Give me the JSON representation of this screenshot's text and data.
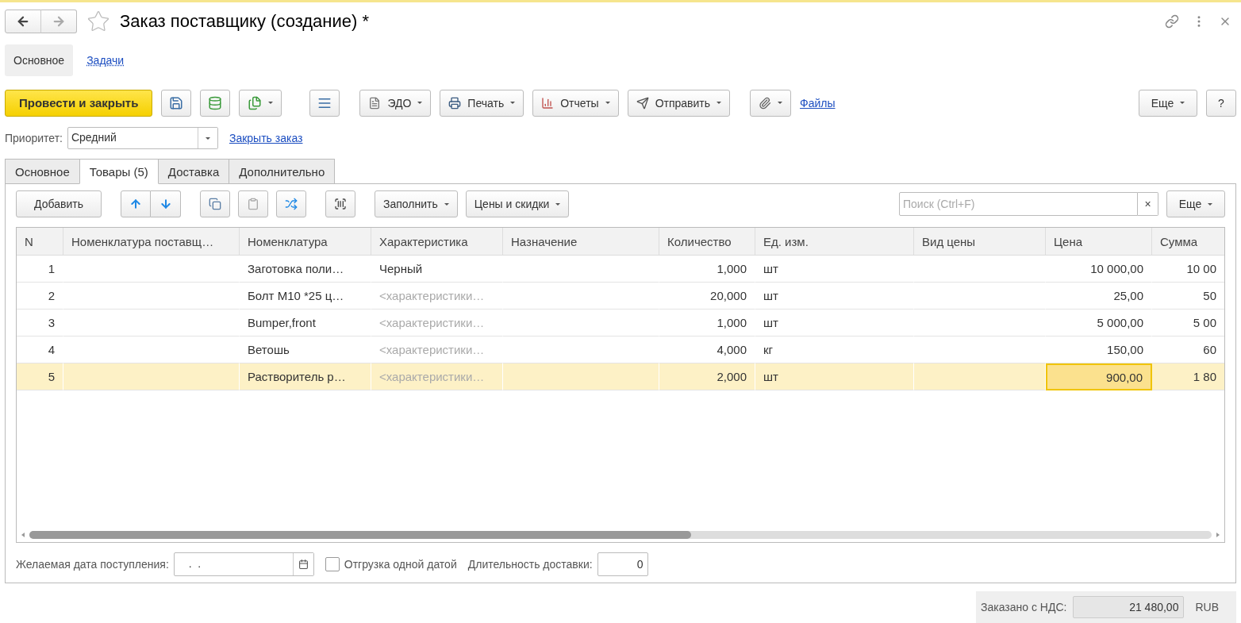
{
  "window": {
    "title": "Заказ поставщику (создание) *",
    "favorite": false
  },
  "sections": [
    {
      "label": "Основное",
      "selected": true
    },
    {
      "label": "Задачи",
      "selected": false
    }
  ],
  "toolbar": {
    "primary": "Провести и закрыть",
    "edo": "ЭДО",
    "print": "Печать",
    "reports": "Отчеты",
    "send": "Отправить",
    "files": "Файлы",
    "more": "Еще",
    "help": "?"
  },
  "priority": {
    "label": "Приоритет:",
    "value": "Средний"
  },
  "close_order_link": "Закрыть заказ",
  "tabs": [
    {
      "label": "Основное",
      "selected": false
    },
    {
      "label": "Товары (5)",
      "selected": true
    },
    {
      "label": "Доставка",
      "selected": false
    },
    {
      "label": "Дополнительно",
      "selected": false
    }
  ],
  "table_toolbar": {
    "add": "Добавить",
    "fill": "Заполнить",
    "prices": "Цены и скидки",
    "search_placeholder": "Поиск (Ctrl+F)",
    "clear": "×",
    "more": "Еще"
  },
  "table": {
    "columns": [
      "N",
      "Номенклатура поставщ…",
      "Номенклатура",
      "Характеристика",
      "Назначение",
      "Количество",
      "Ед. изм.",
      "Вид цены",
      "Цена",
      "Сумма"
    ],
    "rows": [
      {
        "n": "1",
        "supplier_item": "",
        "item": "Заготовка поли…",
        "characteristic": "Черный",
        "characteristic_empty": false,
        "purpose": "",
        "quantity": "1,000",
        "unit": "шт",
        "price_type": "",
        "price": "10 000,00",
        "sum": "10 00",
        "selected": false
      },
      {
        "n": "2",
        "supplier_item": "",
        "item": "Болт  М10 *25 ц…",
        "characteristic": "<характеристики…",
        "characteristic_empty": true,
        "purpose": "",
        "quantity": "20,000",
        "unit": "шт",
        "price_type": "",
        "price": "25,00",
        "sum": "50",
        "selected": false
      },
      {
        "n": "3",
        "supplier_item": "",
        "item": "Bumper,front",
        "characteristic": "<характеристики…",
        "characteristic_empty": true,
        "purpose": "",
        "quantity": "1,000",
        "unit": "шт",
        "price_type": "",
        "price": "5 000,00",
        "sum": "5 00",
        "selected": false
      },
      {
        "n": "4",
        "supplier_item": "",
        "item": "Ветошь",
        "characteristic": "<характеристики…",
        "characteristic_empty": true,
        "purpose": "",
        "quantity": "4,000",
        "unit": "кг",
        "price_type": "",
        "price": "150,00",
        "sum": "60",
        "selected": false
      },
      {
        "n": "5",
        "supplier_item": "",
        "item": "Растворитель р…",
        "characteristic": "<характеристики…",
        "characteristic_empty": true,
        "purpose": "",
        "quantity": "2,000",
        "unit": "шт",
        "price_type": "",
        "price": "900,00",
        "sum": "1 80",
        "selected": true
      }
    ]
  },
  "delivery": {
    "date_label": "Желаемая дата поступления:",
    "date_value": " .  .",
    "single_date": {
      "label": "Отгрузка одной датой",
      "checked": false
    },
    "duration_label": "Длительность доставки:",
    "duration_value": "0"
  },
  "totals": {
    "label": "Заказано с НДС:",
    "value": "21 480,00",
    "currency": "RUB"
  }
}
